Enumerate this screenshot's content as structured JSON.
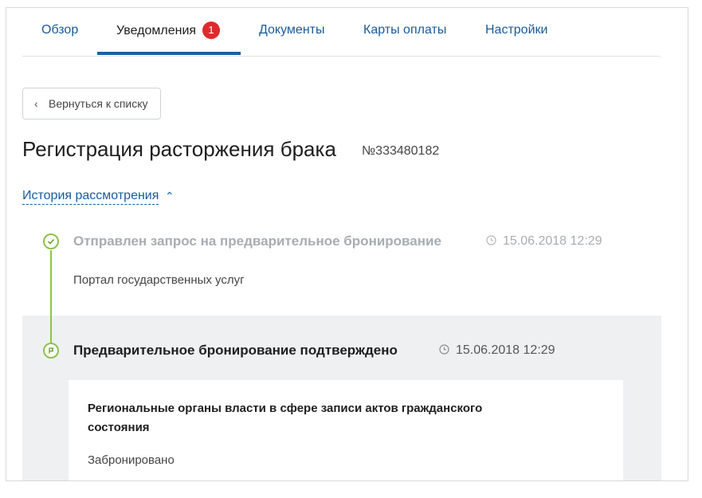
{
  "tabs": [
    {
      "label": "Обзор"
    },
    {
      "label": "Уведомления",
      "badge": "1",
      "active": true
    },
    {
      "label": "Документы"
    },
    {
      "label": "Карты оплаты"
    },
    {
      "label": "Настройки"
    }
  ],
  "back_button": {
    "label": "Вернуться к списку"
  },
  "page": {
    "title": "Регистрация расторжения брака",
    "number": "№333480182"
  },
  "history": {
    "label": "История рассмотрения"
  },
  "events": [
    {
      "title": "Отправлен запрос на предварительное бронирование",
      "time": "15.06.2018 12:29",
      "source": "Портал государственных услуг",
      "state": "done"
    },
    {
      "title": "Предварительное бронирование подтверждено",
      "time": "15.06.2018 12:29",
      "state": "current",
      "card": {
        "org": "Региональные органы власти в сфере записи актов гражданского состояния",
        "status": "Забронировано"
      }
    }
  ],
  "colors": {
    "accent": "#1a5b9a",
    "badge": "#dd2b2b",
    "timeline": "#8bc34a",
    "highlight_bg": "#eef0f2"
  }
}
